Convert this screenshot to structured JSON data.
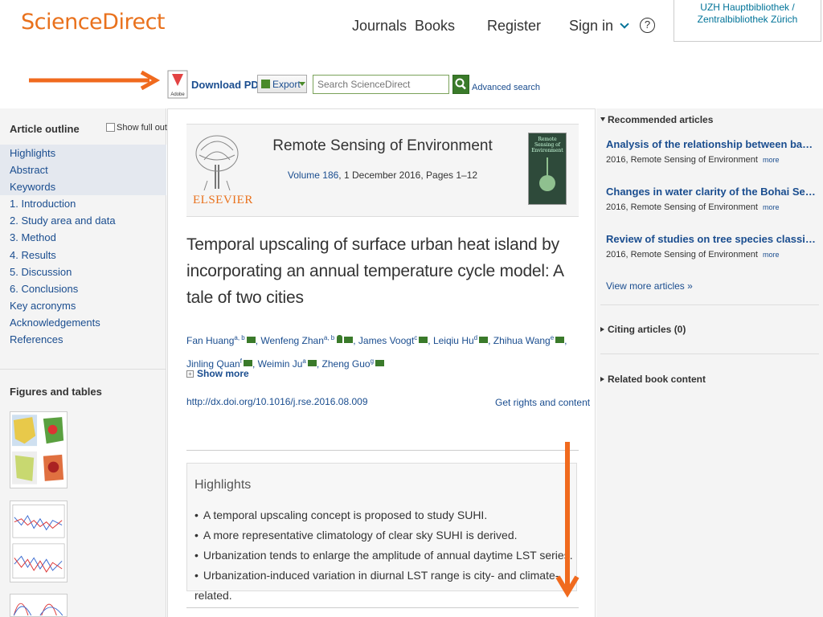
{
  "header": {
    "logo": "ScienceDirect",
    "nav": [
      "Journals",
      "Books",
      "Register",
      "Sign in"
    ],
    "help": "?",
    "institution": "UZH Hauptbibliothek / Zentralbibliothek Zürich"
  },
  "toolbar": {
    "download_pdf": "Download PDF",
    "pdf_icon_text": "Adobe",
    "export": "Export",
    "search_placeholder": "Search ScienceDirect",
    "advanced_search": "Advanced search"
  },
  "outline": {
    "title": "Article outline",
    "show_full": "Show full outline",
    "items": [
      "Highlights",
      "Abstract",
      "Keywords",
      "1. Introduction",
      "2. Study area and data",
      "3. Method",
      "4. Results",
      "5. Discussion",
      "6. Conclusions",
      "Key acronyms",
      "Acknowledgements",
      "References"
    ],
    "figures_title": "Figures and tables"
  },
  "journal": {
    "publisher": "ELSEVIER",
    "title": "Remote Sensing of Environment",
    "volume_link": "Volume 186",
    "volume_rest": ", 1 December 2016, Pages 1–12",
    "cover_text": "Remote Sensing of Environment"
  },
  "article": {
    "title": "Temporal upscaling of surface urban heat island by incorporating an annual temperature cycle model: A tale of two cities",
    "authors": [
      {
        "name": "Fan Huang",
        "sup": "a, b"
      },
      {
        "name": "Wenfeng Zhan",
        "sup": "a, b"
      },
      {
        "name": "James Voogt",
        "sup": "c"
      },
      {
        "name": "Leiqiu Hu",
        "sup": "d"
      },
      {
        "name": "Zhihua Wang",
        "sup": "e"
      },
      {
        "name": "Jinling Quan",
        "sup": "f"
      },
      {
        "name": "Weimin Ju",
        "sup": "a"
      },
      {
        "name": "Zheng Guo",
        "sup": "g"
      }
    ],
    "show_more": "Show more",
    "doi": "http://dx.doi.org/10.1016/j.rse.2016.08.009",
    "rights": "Get rights and content"
  },
  "highlights": {
    "title": "Highlights",
    "items": [
      "A temporal upscaling concept is proposed to study SUHI.",
      "A more representative climatology of clear sky SUHI is derived.",
      "Urbanization tends to enlarge the amplitude of annual daytime LST series.",
      "Urbanization-induced variation in diurnal LST range is city- and climate-related."
    ]
  },
  "recommended": {
    "title": "Recommended articles",
    "items": [
      {
        "title": "Analysis of the relationship between backscatt...",
        "meta": "2016, Remote Sensing of Environment",
        "more": "more"
      },
      {
        "title": "Changes in water clarity of the Bohai Sea: Obs...",
        "meta": "2016, Remote Sensing of Environment",
        "more": "more"
      },
      {
        "title": "Review of studies on tree species classificatio...",
        "meta": "2016, Remote Sensing of Environment",
        "more": "more"
      }
    ],
    "view_more": "View more articles »",
    "citing": "Citing articles (0)",
    "related": "Related book content"
  },
  "colors": {
    "brand_orange": "#e9711c",
    "link_blue": "#1a4d8f",
    "green_icon": "#3a7a2a"
  }
}
